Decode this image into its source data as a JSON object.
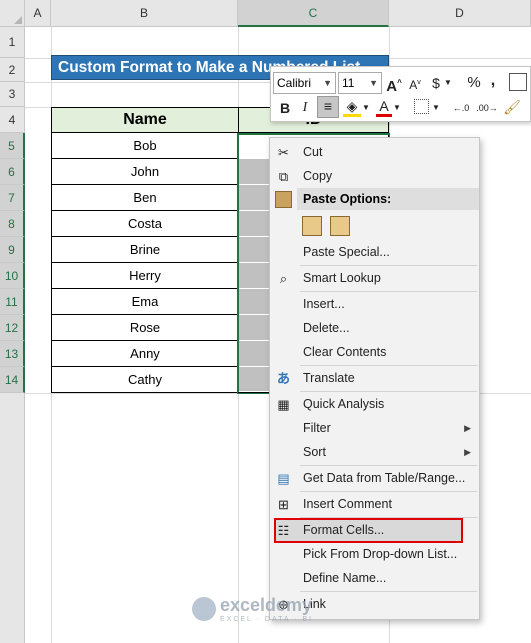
{
  "columns": [
    "A",
    "B",
    "C",
    "D"
  ],
  "rows": [
    "1",
    "2",
    "3",
    "4",
    "5",
    "6",
    "7",
    "8",
    "9",
    "10",
    "11",
    "12",
    "13",
    "14"
  ],
  "title": "Custom Format to Make a Numbered List",
  "table": {
    "header_name": "Name",
    "header_id": "ID",
    "names": [
      "Bob",
      "John",
      "Ben",
      "Costa",
      "Brine",
      "Herry",
      "Ema",
      "Rose",
      "Anny",
      "Cathy"
    ]
  },
  "mini_toolbar": {
    "font": "Calibri",
    "size": "11",
    "bold": "B",
    "italic": "I",
    "currency": "$",
    "percent": "%",
    "comma": ",",
    "grow": "A",
    "shrink": "A"
  },
  "menu": {
    "cut": "Cut",
    "copy": "Copy",
    "paste_options": "Paste Options:",
    "paste_special": "Paste Special...",
    "smart_lookup": "Smart Lookup",
    "insert": "Insert...",
    "delete": "Delete...",
    "clear_contents": "Clear Contents",
    "translate": "Translate",
    "quick_analysis": "Quick Analysis",
    "filter": "Filter",
    "sort": "Sort",
    "get_data": "Get Data from Table/Range...",
    "insert_comment": "Insert Comment",
    "format_cells": "Format Cells...",
    "pick_list": "Pick From Drop-down List...",
    "define_name": "Define Name...",
    "link": "Link"
  },
  "watermark": {
    "brand": "exceldemy",
    "tag": "EXCEL · DATA · BI"
  },
  "colors": {
    "title_bg": "#2e75b6",
    "header_bg": "#e2efda",
    "selection": "#217346",
    "highlight": "#e00000"
  }
}
